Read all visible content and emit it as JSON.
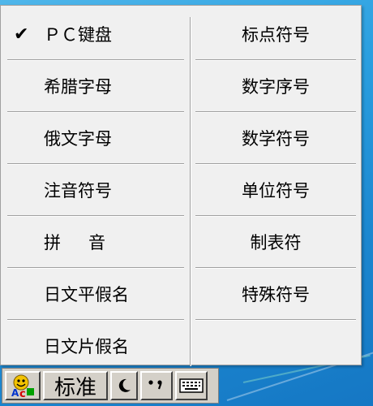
{
  "menu": {
    "left": [
      {
        "label": "ＰＣ键盘",
        "checked": true
      },
      {
        "label": "希腊字母",
        "checked": false
      },
      {
        "label": "俄文字母",
        "checked": false
      },
      {
        "label": "注音符号",
        "checked": false
      },
      {
        "label_a": "拼",
        "label_b": "音",
        "checked": false
      },
      {
        "label": "日文平假名",
        "checked": false
      },
      {
        "label": "日文片假名",
        "checked": false
      }
    ],
    "right": [
      {
        "label": "标点符号"
      },
      {
        "label": "数字序号"
      },
      {
        "label": "数学符号"
      },
      {
        "label": "单位符号"
      },
      {
        "label": "制表符"
      },
      {
        "label": "特殊符号"
      }
    ],
    "check_glyph": "✔"
  },
  "ime_bar": {
    "logo_icon": "ime-logo-icon",
    "mode_label": "标准",
    "halfwidth_icon": "moon-icon",
    "punct_glyph": "•,",
    "keyboard_icon": "soft-keyboard-icon"
  }
}
